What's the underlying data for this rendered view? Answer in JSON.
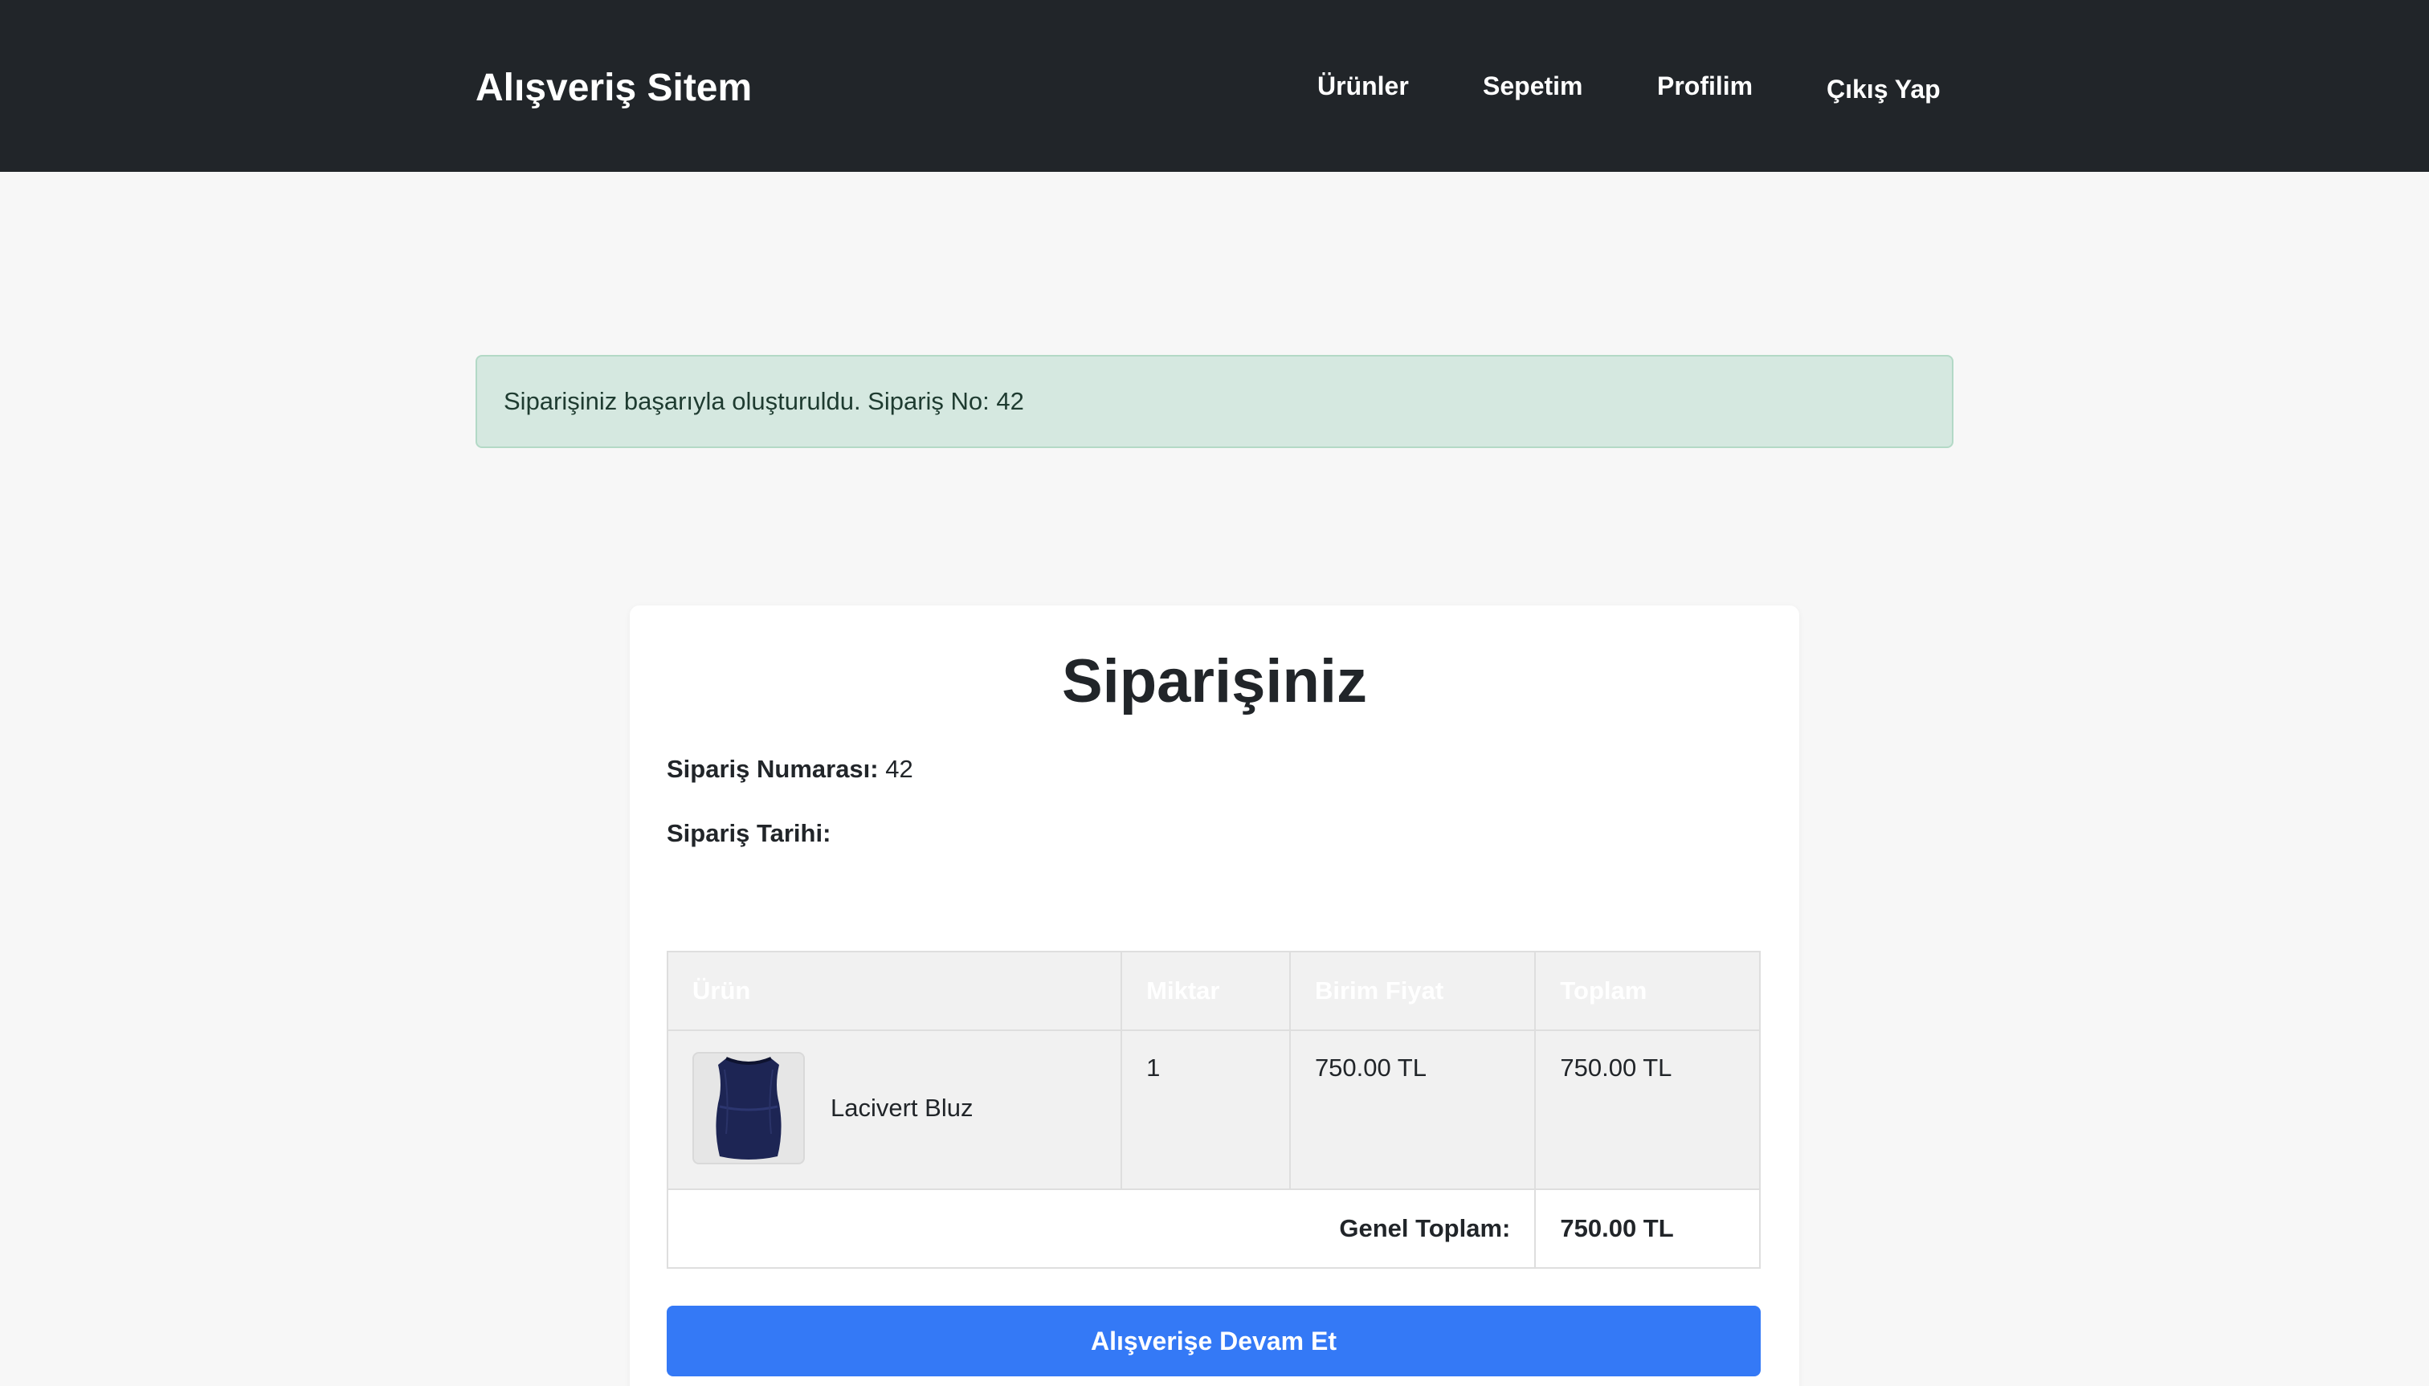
{
  "navbar": {
    "brand": "Alışveriş Sitem",
    "links": [
      "Ürünler",
      "Sepetim",
      "Profilim",
      "Çıkış Yap"
    ],
    "background": "#212529"
  },
  "alert": {
    "message": "Siparişiniz başarıyla oluşturuldu. Sipariş No: 42",
    "background": "#d5e8e0"
  },
  "order": {
    "title": "Siparişiniz",
    "number_label": "Sipariş Numarası:",
    "number_value": "42",
    "date_label": "Sipariş Tarihi:",
    "date_value": "",
    "table": {
      "headers": [
        "Ürün",
        "Miktar",
        "Birim Fiyat",
        "Toplam"
      ],
      "items": [
        {
          "product_name": "Lacivert Bluz",
          "product_image_icon": "navy-blouse-image",
          "quantity": "1",
          "unit_price": "750.00 TL",
          "total": "750.00 TL"
        }
      ],
      "grand_total_label": "Genel Toplam:",
      "grand_total_value": "750.00 TL"
    },
    "continue_button": "Alışverişe Devam Et",
    "accent_color": "#3479f6"
  }
}
